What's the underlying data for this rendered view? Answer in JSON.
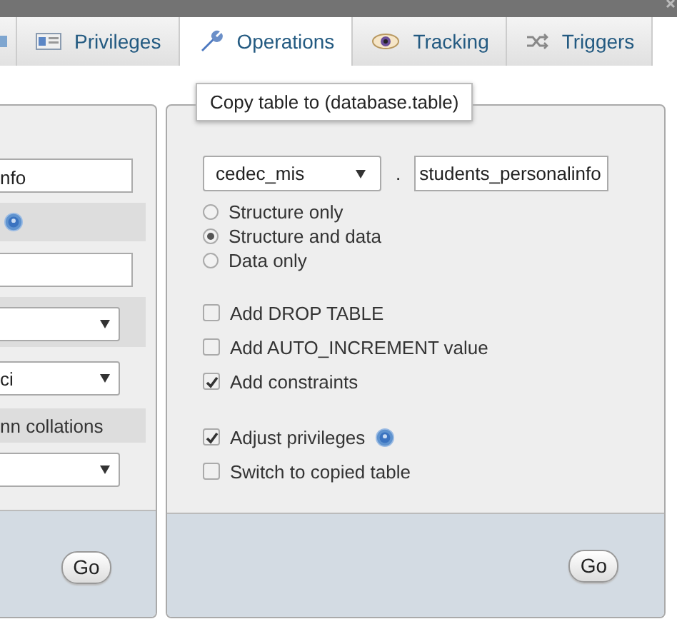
{
  "tabs": [
    {
      "label": "Privileges",
      "selected": false
    },
    {
      "label": "Operations",
      "selected": true
    },
    {
      "label": "Tracking",
      "selected": false
    },
    {
      "label": "Triggers",
      "selected": false
    }
  ],
  "tooltip": "Copy table to (database.table)",
  "left_panel": {
    "rows": [
      {
        "kind": "input",
        "value": "nfo"
      },
      {
        "kind": "help_row"
      },
      {
        "kind": "input"
      },
      {
        "kind": "select_band"
      },
      {
        "kind": "select",
        "value": "ci"
      },
      {
        "kind": "label_row",
        "text": "nn collations"
      },
      {
        "kind": "select"
      }
    ],
    "go_button": "Go"
  },
  "copy_panel": {
    "database": "cedec_mis",
    "separator": ".",
    "table": "students_personalinfo",
    "modes": [
      {
        "label": "Structure only",
        "selected": false
      },
      {
        "label": "Structure and data",
        "selected": true
      },
      {
        "label": "Data only",
        "selected": false
      }
    ],
    "option_groups": [
      [
        {
          "kind": "plain",
          "label": "Add DROP TABLE",
          "checked": false
        },
        {
          "kind": "plain",
          "label": "Add AUTO_INCREMENT value",
          "checked": false
        },
        {
          "kind": "plain",
          "label": "Add constraints",
          "checked": true
        }
      ],
      [
        {
          "kind": "with_help",
          "label": "Adjust privileges",
          "checked": true
        },
        {
          "kind": "plain",
          "label": "Switch to copied table",
          "checked": false
        }
      ]
    ],
    "go_button": "Go"
  }
}
